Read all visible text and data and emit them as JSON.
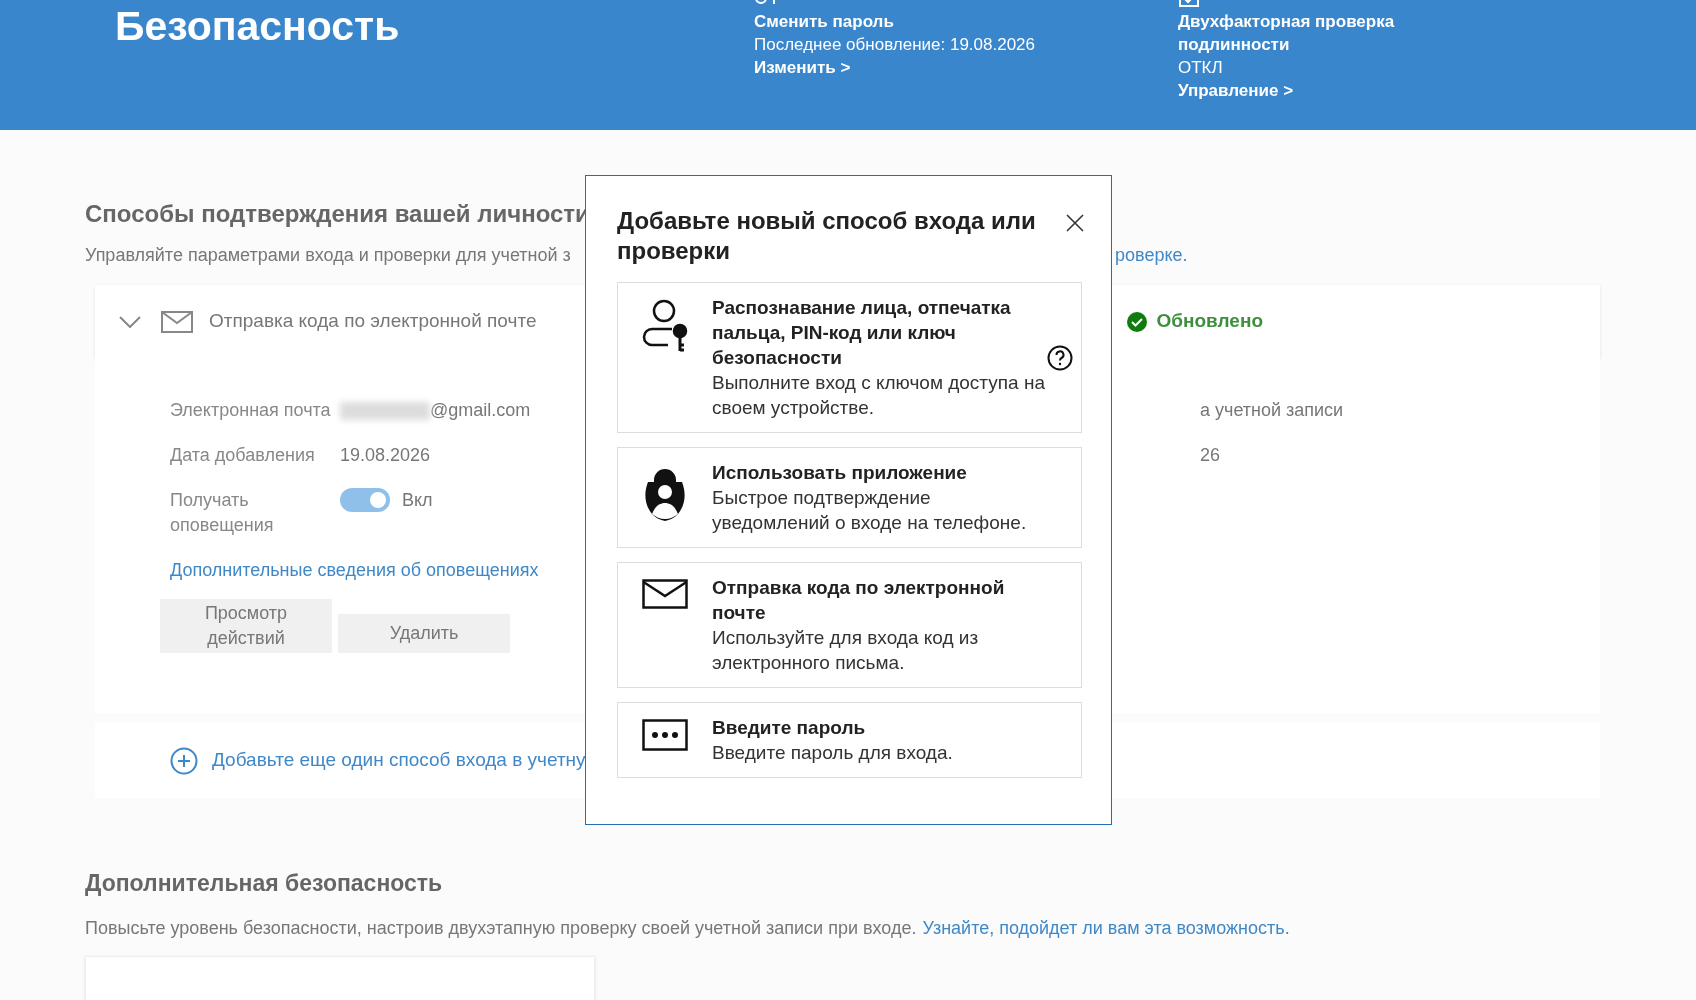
{
  "header": {
    "title": "Безопасность",
    "cards": [
      {
        "kind": "password",
        "title": "Сменить пароль",
        "lines": [
          "Последнее обновление: 19.08.2026"
        ],
        "link": "Изменить >"
      },
      {
        "kind": "twofactor",
        "title": "Двухфакторная проверка подлинности",
        "lines": [
          "ОТКЛ"
        ],
        "link": "Управление >"
      }
    ]
  },
  "methods_section": {
    "heading": "Способы подтверждения вашей личности",
    "description": "Управляйте параметрами входа и проверки для учетной з",
    "description_link": "роверке.",
    "method": {
      "name": "Отправка кода по электронной почте",
      "expanded": true,
      "status": "Обновлено",
      "fields": [
        {
          "label": "Электронная почта",
          "value": "@gmail.com",
          "masked": true
        },
        {
          "label": "Дата добавления",
          "value": "19.08.2026",
          "masked": false
        }
      ],
      "notifications": {
        "label": "Получать оповещения",
        "on": true,
        "state": "Вкл"
      },
      "link": "Дополнительные сведения об оповещениях",
      "buttons": [
        "Просмотр действий",
        "Удалить"
      ],
      "right_fragments": [
        "а учетной записи",
        "26"
      ]
    },
    "add": "Добавьте еще один способ входа в учетну"
  },
  "extra_section": {
    "heading": "Дополнительная безопасность",
    "description": "Повысьте уровень безопасности, настроив двухэтапную проверку своей учетной записи при входе.",
    "link": "Узнайте, подойдет ли вам эта возможность."
  },
  "dialog": {
    "title": "Добавьте новый способ входа или проверки",
    "options": [
      {
        "kind": "passkey",
        "title": "Распознавание лица, отпечатка пальца, PIN-код или ключ безопасности",
        "description": "Выполните вход с ключом доступа на своем устройстве.",
        "help": true
      },
      {
        "kind": "app",
        "title": "Использовать приложение",
        "description": "Быстрое подтверждение уведомлений о входе на телефоне.",
        "help": false
      },
      {
        "kind": "email",
        "title": "Отправка кода по электронной почте",
        "description": "Используйте для входа код из электронного письма.",
        "help": false
      },
      {
        "kind": "password",
        "title": "Введите пароль",
        "description": "Введите пароль для входа.",
        "help": false
      }
    ]
  }
}
